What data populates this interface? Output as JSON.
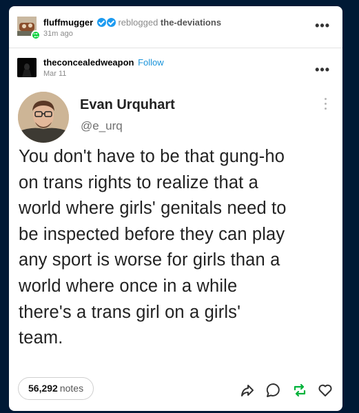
{
  "reblog_header": {
    "blogger": "fluffmugger",
    "action": "reblogged",
    "source": "the-deviations",
    "time": "31m ago"
  },
  "original_post": {
    "author": "theconcealedweapon",
    "follow_label": "Follow",
    "date": "Mar 11"
  },
  "tweet": {
    "display_name": "Evan Urquhart",
    "handle": "@e_urq",
    "text": "You don't have to be that gung-ho\non trans rights to realize that a\nworld where girls' genitals need to\nbe inspected before they can play\nany sport is worse for girls than a\nworld where once in a while\nthere's a trans girl on a girls'\nteam."
  },
  "footer": {
    "notes_count": "56,292",
    "notes_label": "notes"
  },
  "icons": [
    "more-icon",
    "verified-icon",
    "reblog-icon",
    "share-icon",
    "reply-icon",
    "heart-icon"
  ],
  "colors": {
    "background": "#001935",
    "follow": "#1a93d9",
    "reblog_green": "#00b23a",
    "verified": "#1d9bf0"
  }
}
